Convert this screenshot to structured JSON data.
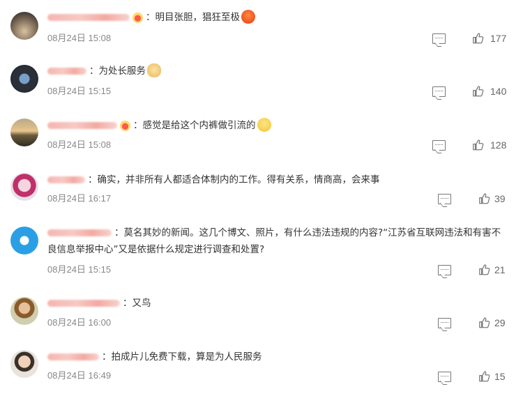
{
  "comments": [
    {
      "name_width": 118,
      "vip": true,
      "text": "明目张胆，猖狂至极",
      "emoji": "angry-face-emoji",
      "time": "08月24日 15:08",
      "likes": "177",
      "avatar": "sunset-city-avatar"
    },
    {
      "name_width": 56,
      "vip": false,
      "text": "为处长服务",
      "emoji": "doge-emoji",
      "time": "08月24日 15:15",
      "likes": "140",
      "avatar": "dark-round-avatar"
    },
    {
      "name_width": 100,
      "vip": true,
      "text": "感觉是给这个内裤做引流的",
      "emoji": "sweat-face-emoji",
      "time": "08月24日 15:08",
      "likes": "128",
      "avatar": "sunset-field-avatar"
    },
    {
      "name_width": 54,
      "vip": false,
      "text": "确实，并非所有人都适合体制内的工作。得有关系，情商高，会来事",
      "emoji": "",
      "time": "08月24日 16:17",
      "likes": "39",
      "avatar": "cartoon-avatar"
    },
    {
      "name_width": 92,
      "vip": false,
      "text": "莫名其妙的新闻。这几个博文、照片，有什么违法违规的内容?“江苏省互联网违法和有害不良信息举报中心”又是依据什么规定进行调查和处置?",
      "emoji": "",
      "time": "08月24日 15:15",
      "likes": "21",
      "avatar": "twitter-bird-avatar"
    },
    {
      "name_width": 104,
      "vip": false,
      "text": "又鸟",
      "emoji": "",
      "time": "08月24日 16:00",
      "likes": "29",
      "avatar": "person-photo-avatar"
    },
    {
      "name_width": 74,
      "vip": false,
      "text": "拍成片儿免费下载，算是为人民服务",
      "emoji": "",
      "time": "08月24日 16:49",
      "likes": "15",
      "avatar": "boy-photo-avatar"
    }
  ],
  "colon": "："
}
